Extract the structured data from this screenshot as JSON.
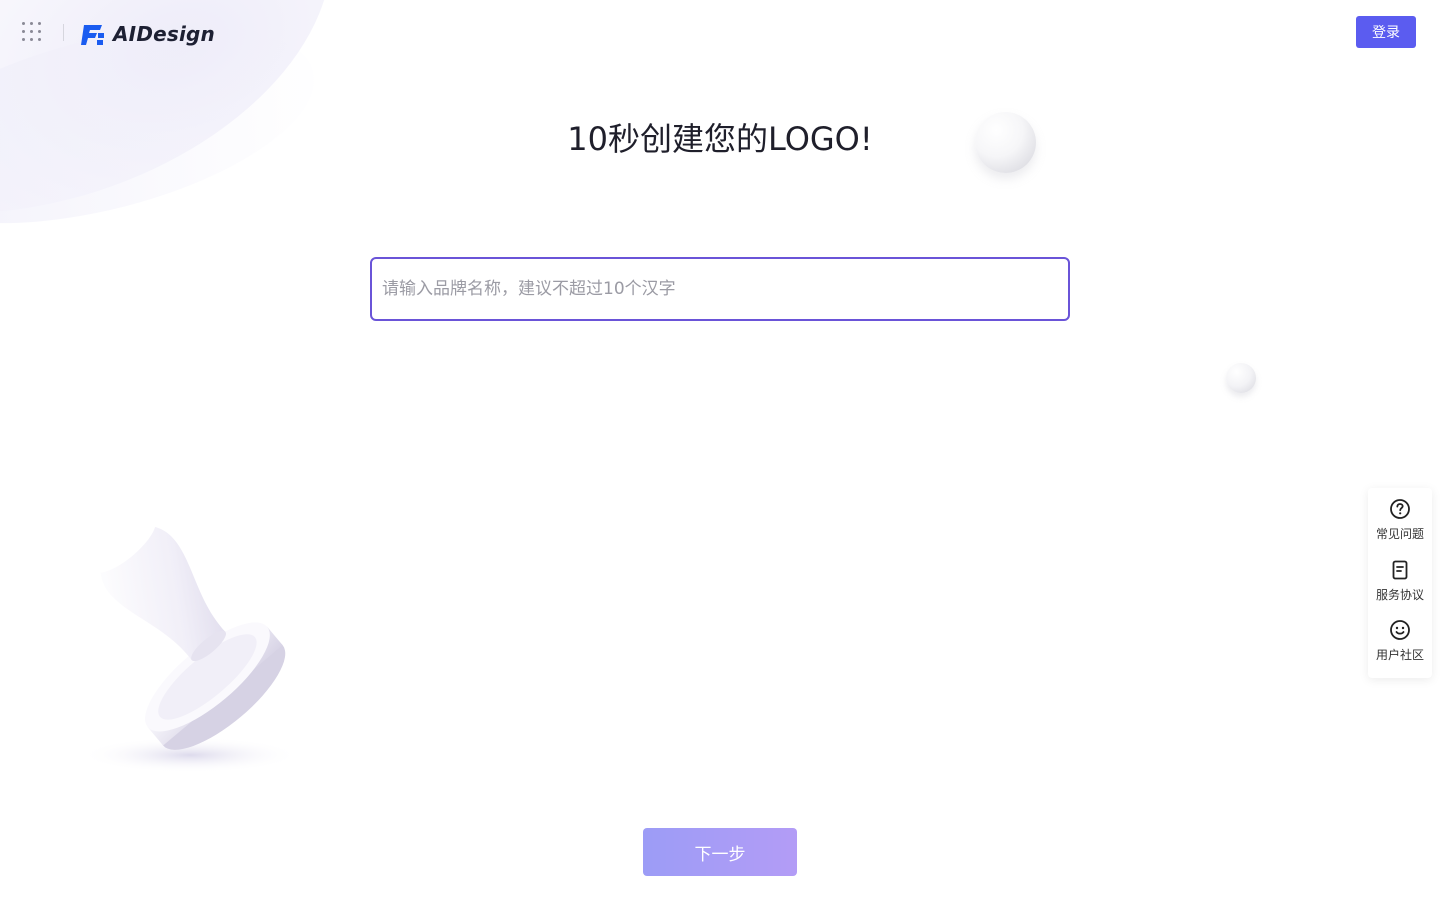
{
  "header": {
    "apps_icon": "grid-dots-icon",
    "logo_text": "AIDesign",
    "login_label": "登录"
  },
  "main": {
    "title": "10秒创建您的LOGO!",
    "brand_input": {
      "placeholder": "请输入品牌名称，建议不超过10个汉字",
      "value": ""
    },
    "next_label": "下一步"
  },
  "side_panel": {
    "items": [
      {
        "icon": "question-circle-icon",
        "label": "常见问题"
      },
      {
        "icon": "document-icon",
        "label": "服务协议"
      },
      {
        "icon": "smiley-icon",
        "label": "用户社区"
      }
    ]
  },
  "colors": {
    "accent": "#5b5cf0",
    "input_border": "#6a54d8",
    "next_button_start": "#9c9cf6",
    "next_button_end": "#b39cf6"
  }
}
